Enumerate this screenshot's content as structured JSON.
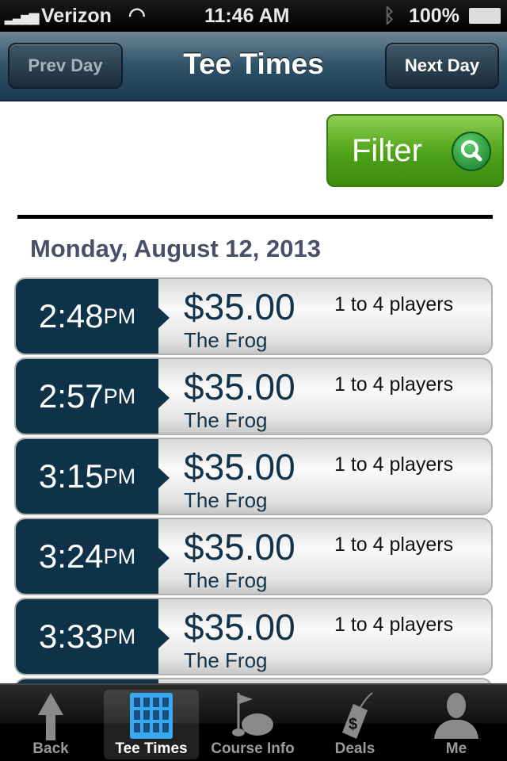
{
  "status": {
    "carrier": "Verizon",
    "time": "11:46 AM",
    "battery": "100%"
  },
  "nav": {
    "title": "Tee Times",
    "prev": "Prev Day",
    "next": "Next Day"
  },
  "filter": {
    "label": "Filter",
    "icon": "search-icon",
    "color": "#4da118"
  },
  "date": "Monday, August 12, 2013",
  "rows": [
    {
      "time": "2:48",
      "ampm": "PM",
      "price": "$35.00",
      "course": "The Frog",
      "players": "1 to 4 players"
    },
    {
      "time": "2:57",
      "ampm": "PM",
      "price": "$35.00",
      "course": "The Frog",
      "players": "1 to 4 players"
    },
    {
      "time": "3:15",
      "ampm": "PM",
      "price": "$35.00",
      "course": "The Frog",
      "players": "1 to 4 players"
    },
    {
      "time": "3:24",
      "ampm": "PM",
      "price": "$35.00",
      "course": "The Frog",
      "players": "1 to 4 players"
    },
    {
      "time": "3:33",
      "ampm": "PM",
      "price": "$35.00",
      "course": "The Frog",
      "players": "1 to 4 players"
    }
  ],
  "tabs": [
    {
      "label": "Back",
      "icon": "arrow-up-icon"
    },
    {
      "label": "Tee Times",
      "icon": "grid-icon",
      "selected": true
    },
    {
      "label": "Course Info",
      "icon": "golf-flag-icon"
    },
    {
      "label": "Deals",
      "icon": "price-tag-icon"
    },
    {
      "label": "Me",
      "icon": "person-icon"
    }
  ]
}
